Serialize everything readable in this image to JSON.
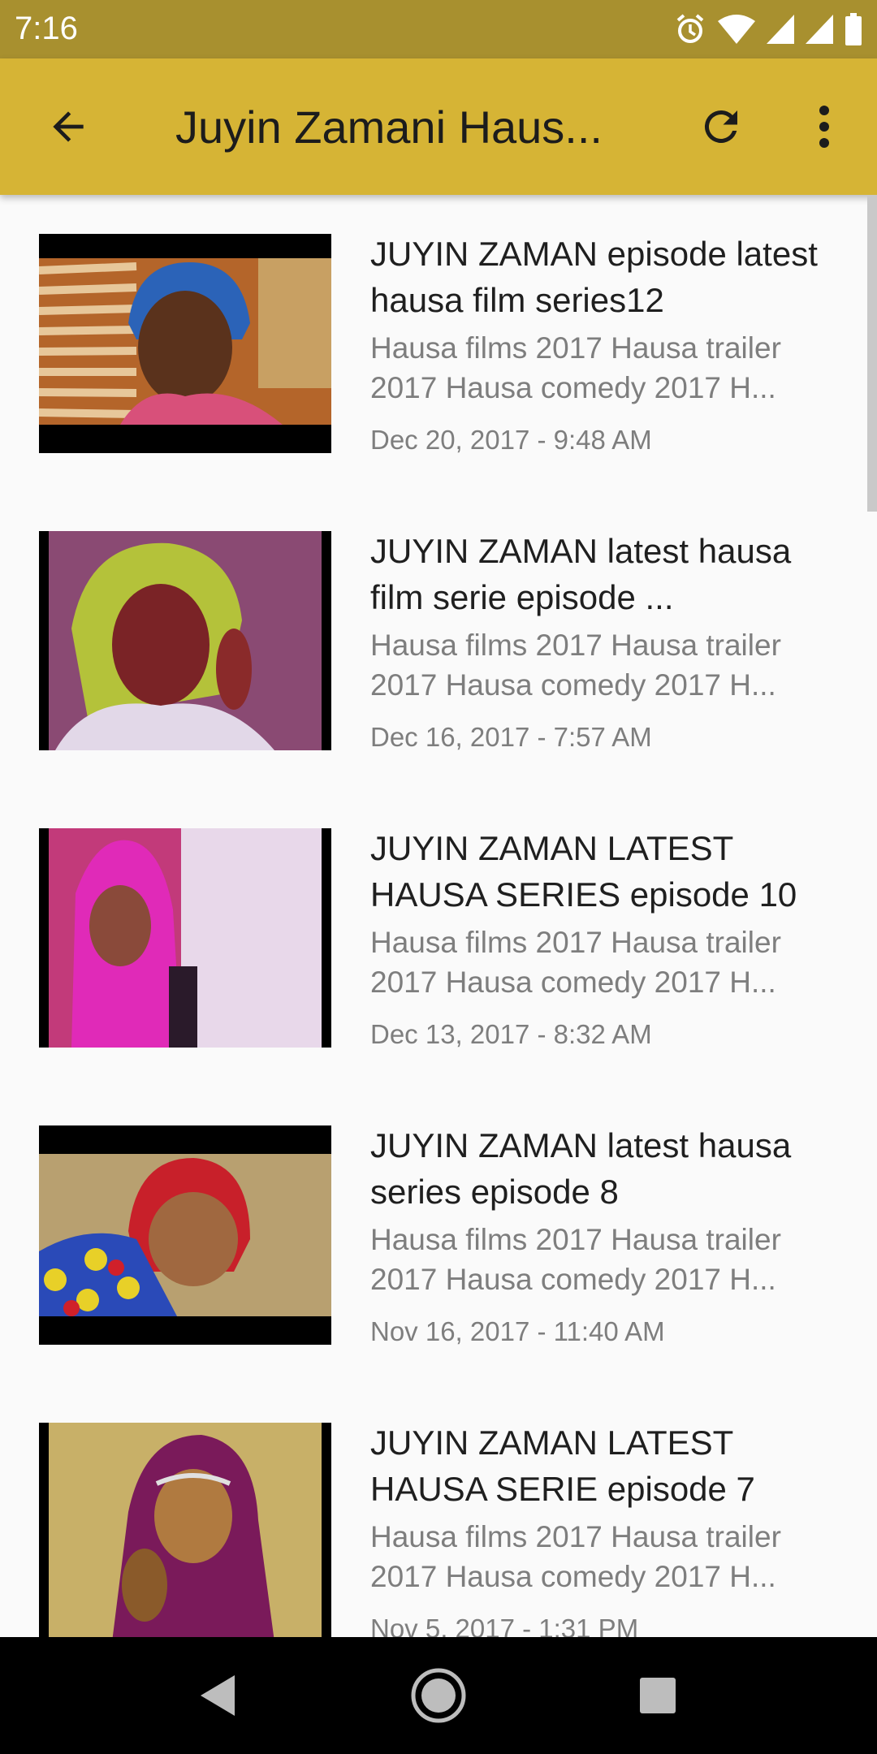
{
  "status_bar": {
    "time": "7:16",
    "icons": [
      "alarm-icon",
      "wifi-icon",
      "signal-icon",
      "signal-icon",
      "battery-icon"
    ]
  },
  "app_bar": {
    "title": "Juyin Zamani Haus...",
    "back_icon": "arrow-back-icon",
    "refresh_icon": "refresh-icon",
    "more_icon": "more-vertical-icon",
    "background": "#d6b435"
  },
  "videos": [
    {
      "title": "JUYIN ZAMAN episode latest hausa film series12",
      "description": "Hausa films 2017 Hausa trailer 2017 Hausa comedy 2017 H...",
      "date": "Dec 20, 2017 - 9:48 AM"
    },
    {
      "title": "JUYIN ZAMAN latest hausa film serie episode ...",
      "description": "Hausa films 2017 Hausa trailer 2017 Hausa comedy 2017 H...",
      "date": "Dec 16, 2017 - 7:57 AM"
    },
    {
      "title": "JUYIN ZAMAN LATEST HAUSA SERIES episode 10",
      "description": "Hausa films 2017 Hausa trailer 2017 Hausa comedy 2017 H...",
      "date": "Dec 13, 2017 - 8:32 AM"
    },
    {
      "title": "JUYIN ZAMAN latest hausa series episode 8",
      "description": "Hausa films 2017 Hausa trailer 2017 Hausa comedy 2017 H...",
      "date": "Nov 16, 2017 - 11:40 AM"
    },
    {
      "title": "JUYIN ZAMAN LATEST HAUSA SERIE episode 7",
      "description": "Hausa films 2017 Hausa trailer 2017 Hausa comedy 2017 H...",
      "date": "Nov 5, 2017 - 1:31 PM"
    }
  ],
  "nav_bar": {
    "icons": [
      "back-triangle-icon",
      "home-circle-icon",
      "recents-square-icon"
    ]
  }
}
